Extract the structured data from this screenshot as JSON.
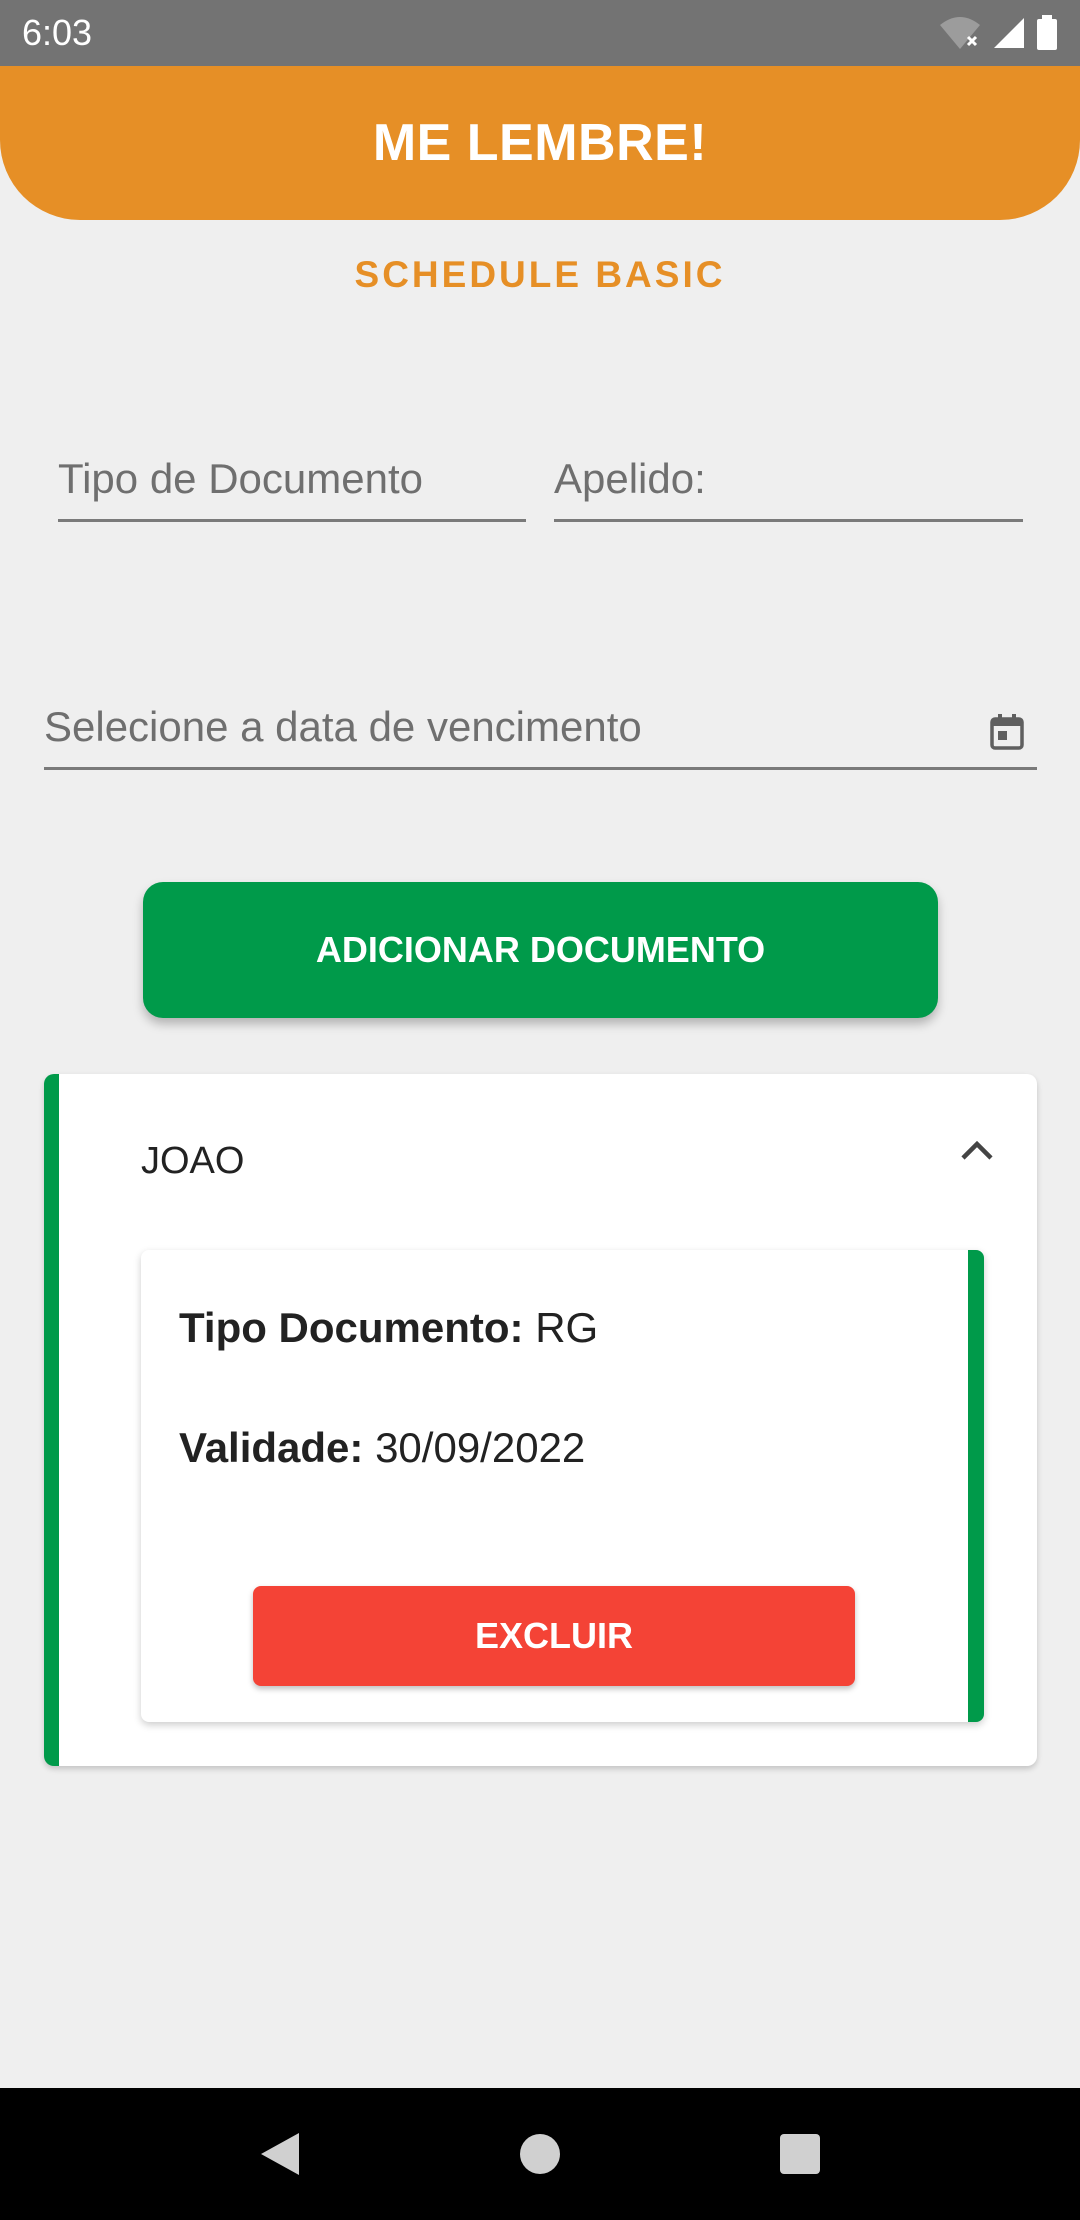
{
  "status_bar": {
    "time": "6:03",
    "icons": [
      "wifi-icon",
      "signal-icon",
      "battery-icon"
    ]
  },
  "header": {
    "title": "ME LEMBRE!",
    "subtitle": "SCHEDULE BASIC"
  },
  "form": {
    "document_type_placeholder": "Tipo de Documento",
    "nickname_placeholder": "Apelido:",
    "due_date_placeholder": "Selecione a data de vencimento",
    "add_button_label": "ADICIONAR DOCUMENTO"
  },
  "card": {
    "title": "JOAO",
    "document_type_label": "Tipo Documento:",
    "document_type_value": "RG",
    "validity_label": "Validade:",
    "validity_value": "30/09/2022",
    "delete_button_label": "EXCLUIR"
  },
  "nav_bar": {
    "buttons": [
      "back-icon",
      "home-icon",
      "recents-icon"
    ]
  },
  "colors": {
    "primary": "#e68f26",
    "success": "#009a4a",
    "danger": "#f44336",
    "background": "#efefef"
  }
}
